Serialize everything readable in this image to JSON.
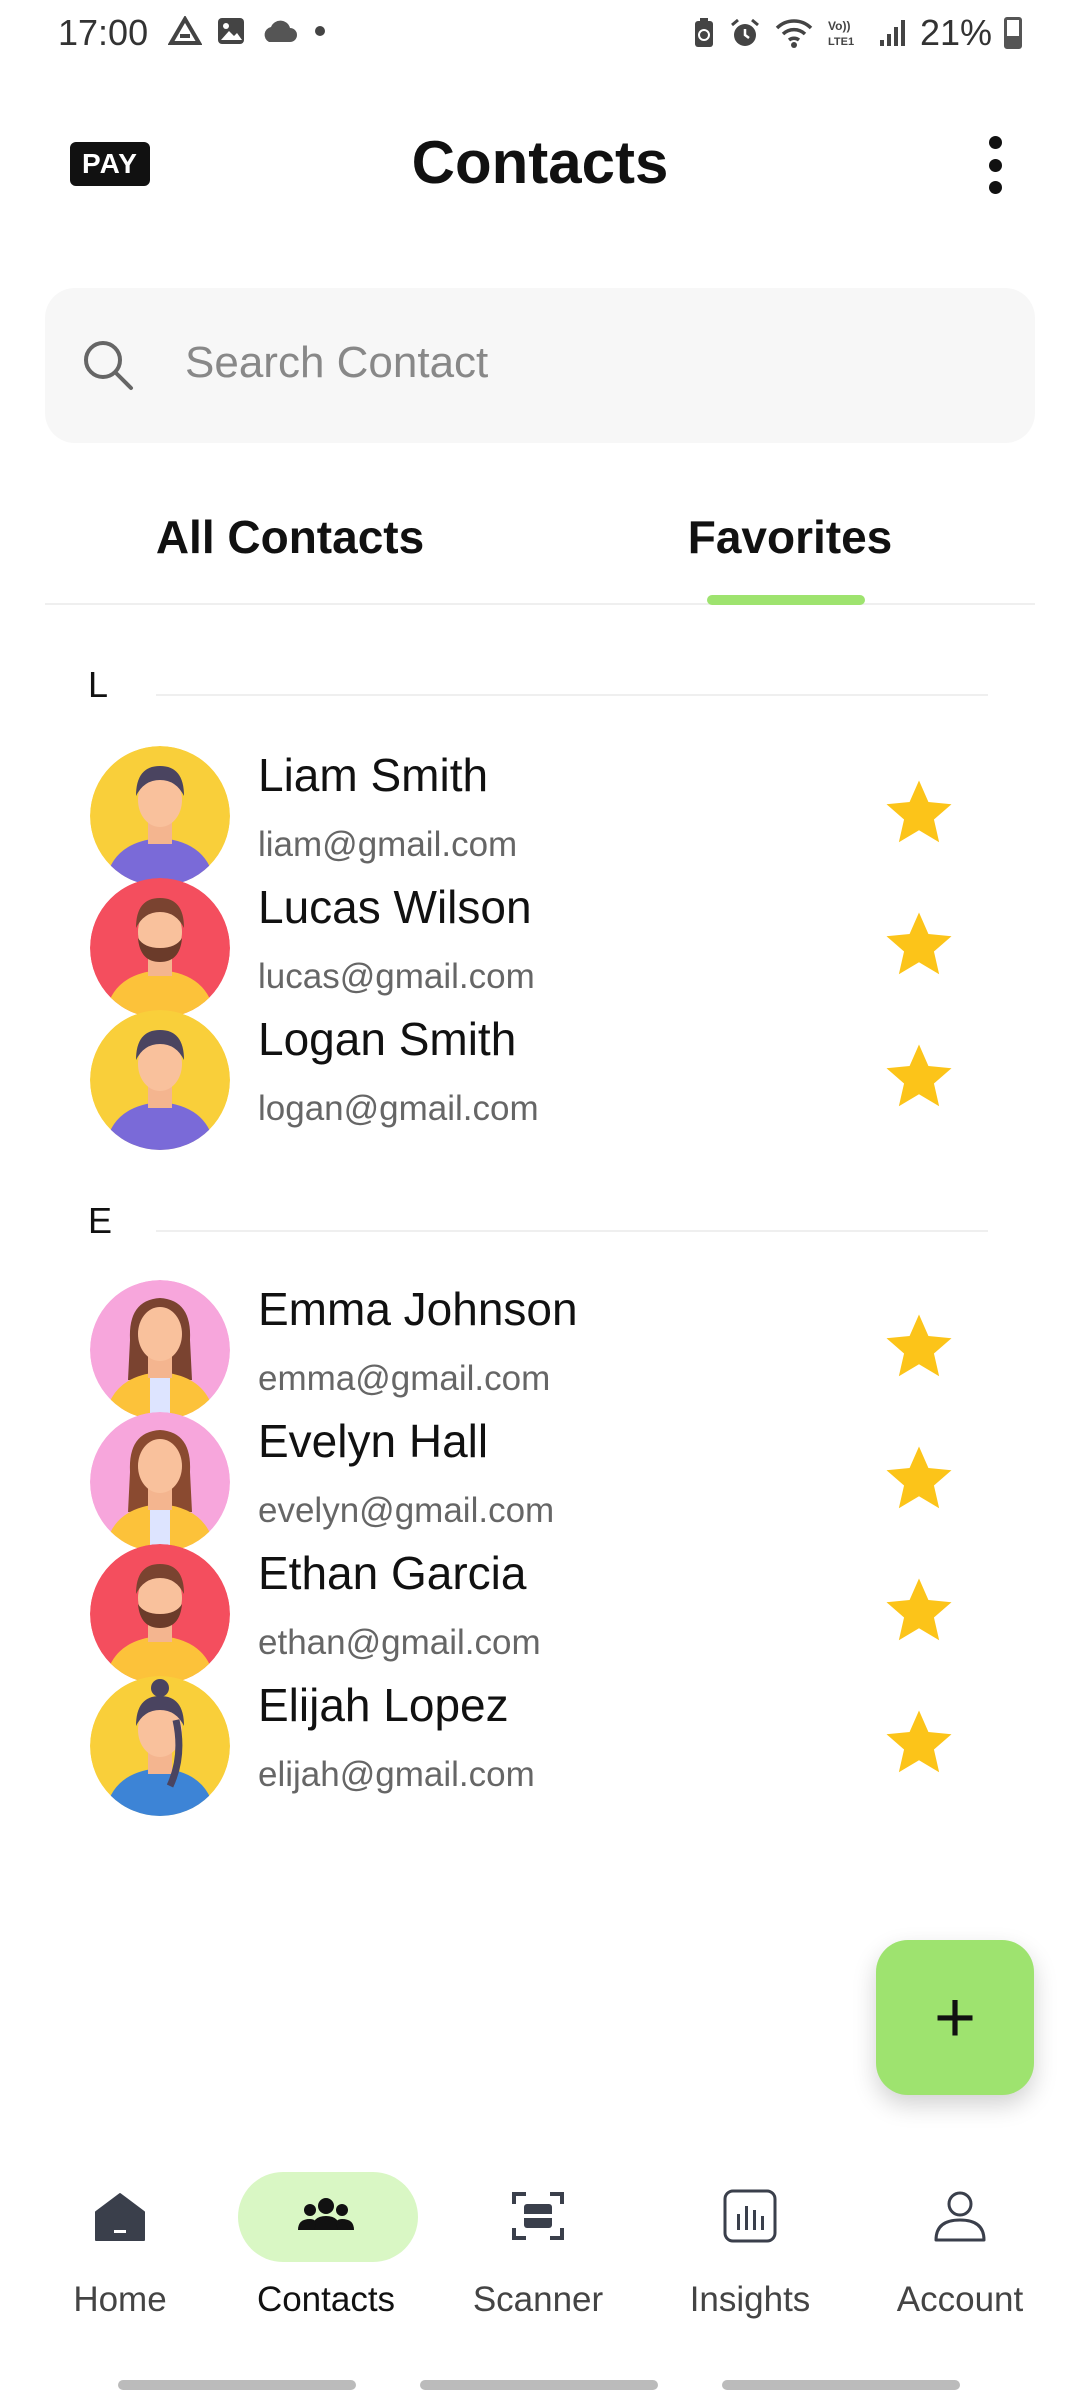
{
  "status_bar": {
    "time": "17:00",
    "battery_text": "21%",
    "icons_left": [
      "drive-icon",
      "image-icon",
      "cloud-icon",
      "dot-icon"
    ],
    "icons_right": [
      "battery-saver-icon",
      "alarm-icon",
      "wifi-icon",
      "volte-icon",
      "signal-icon"
    ]
  },
  "header": {
    "logo_text": "PAY",
    "title": "Contacts",
    "menu_icon": "kebab-menu-icon"
  },
  "search": {
    "placeholder": "Search Contact",
    "value": ""
  },
  "tabs": [
    {
      "label": "All Contacts",
      "active": false
    },
    {
      "label": "Favorites",
      "active": true
    }
  ],
  "accent_color": "#9ee36f",
  "sections": [
    {
      "letter": "L",
      "contacts": [
        {
          "name": "Liam Smith",
          "email": "liam@gmail.com",
          "favorite": true,
          "avatar": "man-yellow"
        },
        {
          "name": "Lucas Wilson",
          "email": "lucas@gmail.com",
          "favorite": true,
          "avatar": "man-beard-red"
        },
        {
          "name": "Logan Smith",
          "email": "logan@gmail.com",
          "favorite": true,
          "avatar": "man-yellow"
        }
      ]
    },
    {
      "letter": "E",
      "contacts": [
        {
          "name": "Emma Johnson",
          "email": "emma@gmail.com",
          "favorite": true,
          "avatar": "woman-pink"
        },
        {
          "name": "Evelyn Hall",
          "email": "evelyn@gmail.com",
          "favorite": true,
          "avatar": "woman-pink"
        },
        {
          "name": "Ethan Garcia",
          "email": "ethan@gmail.com",
          "favorite": true,
          "avatar": "man-beard-red"
        },
        {
          "name": "Elijah Lopez",
          "email": "elijah@gmail.com",
          "favorite": true,
          "avatar": "woman-bun-yellow"
        }
      ]
    }
  ],
  "fab": {
    "label": "+"
  },
  "bottom_nav": [
    {
      "label": "Home",
      "icon": "home-icon",
      "active": false
    },
    {
      "label": "Contacts",
      "icon": "contacts-icon",
      "active": true
    },
    {
      "label": "Scanner",
      "icon": "scanner-icon",
      "active": false
    },
    {
      "label": "Insights",
      "icon": "insights-icon",
      "active": false
    },
    {
      "label": "Account",
      "icon": "account-icon",
      "active": false
    }
  ]
}
